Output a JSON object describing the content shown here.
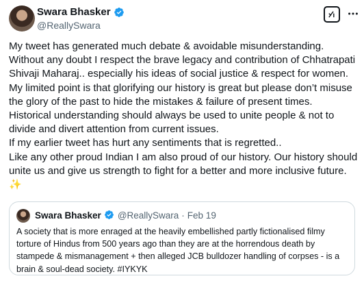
{
  "author": {
    "name": "Swara Bhasker",
    "handle": "@ReallySwara"
  },
  "tweet": {
    "lines": [
      "My tweet has generated much debate & avoidable misunderstanding.",
      "Without any doubt I respect the brave legacy and contribution of Chhatrapati",
      "Shivaji Maharaj.. especially his ideas of social justice & respect for women.",
      "My limited point is that glorifying our  history is great but please don’t misuse",
      "the glory of the past to hide the mistakes & failure of present times.",
      "Historical understanding should always be used to unite people & not to",
      "divide and divert attention from current issues.",
      "If my earlier  tweet has hurt any sentiments that is regretted..",
      "Like any other proud Indian I am also  proud of our history. Our history should",
      "unite us and give us strength to fight for a better and more inclusive future."
    ],
    "emoji": "✨"
  },
  "quoted": {
    "name": "Swara Bhasker",
    "handle": "@ReallySwara",
    "date": "Feb 19",
    "separator": "·",
    "lines": [
      "A society that is more enraged at the heavily embellished partly fictionalised filmy",
      "torture of Hindus from 500 years ago than they are at the horrendous death by",
      "stampede & mismanagement + then alleged JCB bulldozer handling of corpses - is a",
      "brain & soul-dead society. #IYKYK"
    ]
  },
  "icons": {
    "verified": "verified-badge-icon",
    "grok": "grok-icon",
    "more": "more-options-icon"
  },
  "colors": {
    "verified_blue": "#1d9bf0",
    "text": "#0f1419",
    "secondary_text": "#536471",
    "border": "#cfd9de"
  }
}
